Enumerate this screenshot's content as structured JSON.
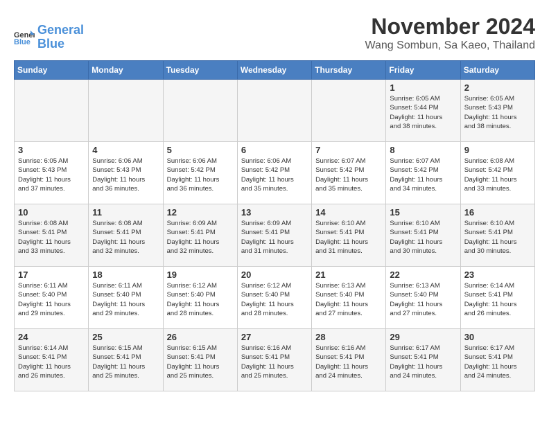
{
  "logo": {
    "line1": "General",
    "line2": "Blue"
  },
  "title": "November 2024",
  "location": "Wang Sombun, Sa Kaeo, Thailand",
  "days_of_week": [
    "Sunday",
    "Monday",
    "Tuesday",
    "Wednesday",
    "Thursday",
    "Friday",
    "Saturday"
  ],
  "weeks": [
    [
      {
        "day": "",
        "info": ""
      },
      {
        "day": "",
        "info": ""
      },
      {
        "day": "",
        "info": ""
      },
      {
        "day": "",
        "info": ""
      },
      {
        "day": "",
        "info": ""
      },
      {
        "day": "1",
        "info": "Sunrise: 6:05 AM\nSunset: 5:44 PM\nDaylight: 11 hours\nand 38 minutes."
      },
      {
        "day": "2",
        "info": "Sunrise: 6:05 AM\nSunset: 5:43 PM\nDaylight: 11 hours\nand 38 minutes."
      }
    ],
    [
      {
        "day": "3",
        "info": "Sunrise: 6:05 AM\nSunset: 5:43 PM\nDaylight: 11 hours\nand 37 minutes."
      },
      {
        "day": "4",
        "info": "Sunrise: 6:06 AM\nSunset: 5:43 PM\nDaylight: 11 hours\nand 36 minutes."
      },
      {
        "day": "5",
        "info": "Sunrise: 6:06 AM\nSunset: 5:42 PM\nDaylight: 11 hours\nand 36 minutes."
      },
      {
        "day": "6",
        "info": "Sunrise: 6:06 AM\nSunset: 5:42 PM\nDaylight: 11 hours\nand 35 minutes."
      },
      {
        "day": "7",
        "info": "Sunrise: 6:07 AM\nSunset: 5:42 PM\nDaylight: 11 hours\nand 35 minutes."
      },
      {
        "day": "8",
        "info": "Sunrise: 6:07 AM\nSunset: 5:42 PM\nDaylight: 11 hours\nand 34 minutes."
      },
      {
        "day": "9",
        "info": "Sunrise: 6:08 AM\nSunset: 5:42 PM\nDaylight: 11 hours\nand 33 minutes."
      }
    ],
    [
      {
        "day": "10",
        "info": "Sunrise: 6:08 AM\nSunset: 5:41 PM\nDaylight: 11 hours\nand 33 minutes."
      },
      {
        "day": "11",
        "info": "Sunrise: 6:08 AM\nSunset: 5:41 PM\nDaylight: 11 hours\nand 32 minutes."
      },
      {
        "day": "12",
        "info": "Sunrise: 6:09 AM\nSunset: 5:41 PM\nDaylight: 11 hours\nand 32 minutes."
      },
      {
        "day": "13",
        "info": "Sunrise: 6:09 AM\nSunset: 5:41 PM\nDaylight: 11 hours\nand 31 minutes."
      },
      {
        "day": "14",
        "info": "Sunrise: 6:10 AM\nSunset: 5:41 PM\nDaylight: 11 hours\nand 31 minutes."
      },
      {
        "day": "15",
        "info": "Sunrise: 6:10 AM\nSunset: 5:41 PM\nDaylight: 11 hours\nand 30 minutes."
      },
      {
        "day": "16",
        "info": "Sunrise: 6:10 AM\nSunset: 5:41 PM\nDaylight: 11 hours\nand 30 minutes."
      }
    ],
    [
      {
        "day": "17",
        "info": "Sunrise: 6:11 AM\nSunset: 5:40 PM\nDaylight: 11 hours\nand 29 minutes."
      },
      {
        "day": "18",
        "info": "Sunrise: 6:11 AM\nSunset: 5:40 PM\nDaylight: 11 hours\nand 29 minutes."
      },
      {
        "day": "19",
        "info": "Sunrise: 6:12 AM\nSunset: 5:40 PM\nDaylight: 11 hours\nand 28 minutes."
      },
      {
        "day": "20",
        "info": "Sunrise: 6:12 AM\nSunset: 5:40 PM\nDaylight: 11 hours\nand 28 minutes."
      },
      {
        "day": "21",
        "info": "Sunrise: 6:13 AM\nSunset: 5:40 PM\nDaylight: 11 hours\nand 27 minutes."
      },
      {
        "day": "22",
        "info": "Sunrise: 6:13 AM\nSunset: 5:40 PM\nDaylight: 11 hours\nand 27 minutes."
      },
      {
        "day": "23",
        "info": "Sunrise: 6:14 AM\nSunset: 5:41 PM\nDaylight: 11 hours\nand 26 minutes."
      }
    ],
    [
      {
        "day": "24",
        "info": "Sunrise: 6:14 AM\nSunset: 5:41 PM\nDaylight: 11 hours\nand 26 minutes."
      },
      {
        "day": "25",
        "info": "Sunrise: 6:15 AM\nSunset: 5:41 PM\nDaylight: 11 hours\nand 25 minutes."
      },
      {
        "day": "26",
        "info": "Sunrise: 6:15 AM\nSunset: 5:41 PM\nDaylight: 11 hours\nand 25 minutes."
      },
      {
        "day": "27",
        "info": "Sunrise: 6:16 AM\nSunset: 5:41 PM\nDaylight: 11 hours\nand 25 minutes."
      },
      {
        "day": "28",
        "info": "Sunrise: 6:16 AM\nSunset: 5:41 PM\nDaylight: 11 hours\nand 24 minutes."
      },
      {
        "day": "29",
        "info": "Sunrise: 6:17 AM\nSunset: 5:41 PM\nDaylight: 11 hours\nand 24 minutes."
      },
      {
        "day": "30",
        "info": "Sunrise: 6:17 AM\nSunset: 5:41 PM\nDaylight: 11 hours\nand 24 minutes."
      }
    ]
  ]
}
